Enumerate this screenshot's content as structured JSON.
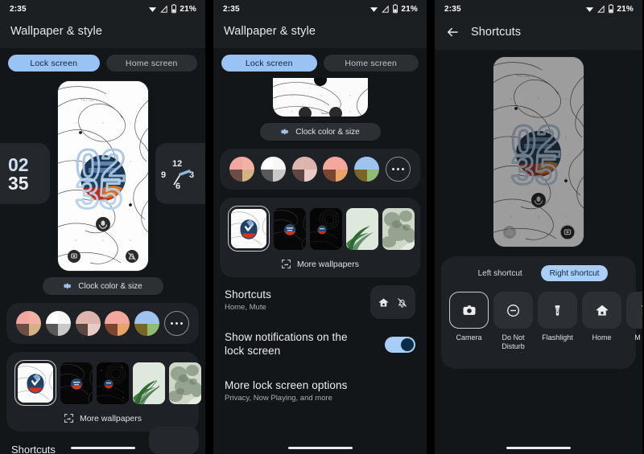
{
  "statusbar": {
    "time": "2:35",
    "battery": "21%",
    "icons": [
      "wifi-icon",
      "signal-icon",
      "battery-icon"
    ]
  },
  "panel1": {
    "app_title": "Wallpaper & style",
    "tabs": [
      {
        "label": "Lock screen",
        "active": true
      },
      {
        "label": "Home screen",
        "active": false
      }
    ],
    "preview": {
      "clock_time": "0235",
      "date": "Thu, Sep 1",
      "side_clock_left": "0235",
      "side_clock_right": "12 3 6 9"
    },
    "clock_pill": {
      "label": "Clock color & size",
      "icon": "gear-icon"
    },
    "color_swatches": [
      {
        "name": "swatch-pink-tan",
        "q1": "#f2a6a0",
        "q2": "#f3b0a4",
        "q3": "#6b4f46",
        "q4": "#d6b183"
      },
      {
        "name": "swatch-white-gray",
        "q1": "#ffffff",
        "q2": "#f7f7f7",
        "q3": "#59595a",
        "q4": "#c9c9c9"
      },
      {
        "name": "swatch-rose-mauve",
        "q1": "#e0b5ae",
        "q2": "#ddb4ad",
        "q3": "#5d4741",
        "q4": "#e8cbc4"
      },
      {
        "name": "swatch-salmon-orange",
        "q1": "#f4a79c",
        "q2": "#f4a79c",
        "q3": "#7b4530",
        "q4": "#e8a368"
      },
      {
        "name": "swatch-blue-green",
        "q1": "#9ec3ef",
        "q2": "#9ec3ef",
        "q3": "#7a6526",
        "q4": "#8fbb73"
      }
    ],
    "more_colors_label": "More colors",
    "wallpapers": [
      {
        "name": "wallpaper-current-selected",
        "selected": true
      },
      {
        "name": "wallpaper-dark-topo-1",
        "selected": false
      },
      {
        "name": "wallpaper-dark-topo-2",
        "selected": false
      },
      {
        "name": "wallpaper-palm-leaf",
        "selected": false
      },
      {
        "name": "wallpaper-green-marble",
        "selected": false
      }
    ],
    "more_wallpapers": {
      "label": "More wallpapers",
      "icon": "image-frame-icon"
    },
    "bottom_cut_label": "Shortcuts"
  },
  "panel2": {
    "app_title": "Wallpaper & style",
    "tabs": [
      {
        "label": "Lock screen",
        "active": true
      },
      {
        "label": "Home screen",
        "active": false
      }
    ],
    "clock_pill": {
      "label": "Clock color & size",
      "icon": "gear-icon"
    },
    "color_swatches": [
      {
        "name": "swatch-pink-tan",
        "q1": "#f2a6a0",
        "q2": "#f3b0a4",
        "q3": "#6b4f46",
        "q4": "#d6b183"
      },
      {
        "name": "swatch-white-gray",
        "q1": "#ffffff",
        "q2": "#f7f7f7",
        "q3": "#59595a",
        "q4": "#c9c9c9"
      },
      {
        "name": "swatch-rose-mauve",
        "q1": "#e0b5ae",
        "q2": "#ddb4ad",
        "q3": "#5d4741",
        "q4": "#e8cbc4"
      },
      {
        "name": "swatch-salmon-orange",
        "q1": "#f4a79c",
        "q2": "#f4a79c",
        "q3": "#7b4530",
        "q4": "#e8a368"
      },
      {
        "name": "swatch-blue-green",
        "q1": "#9ec3ef",
        "q2": "#9ec3ef",
        "q3": "#7a6526",
        "q4": "#8fbb73"
      }
    ],
    "wallpapers": [
      {
        "name": "wallpaper-current-selected",
        "selected": true
      },
      {
        "name": "wallpaper-dark-topo-1",
        "selected": false
      },
      {
        "name": "wallpaper-dark-topo-2",
        "selected": false
      },
      {
        "name": "wallpaper-palm-leaf",
        "selected": false
      },
      {
        "name": "wallpaper-green-marble",
        "selected": false
      }
    ],
    "more_wallpapers": {
      "label": "More wallpapers",
      "icon": "image-frame-icon"
    },
    "rows": [
      {
        "title": "Shortcuts",
        "subtitle": "Home, Mute",
        "trailing": "shortcut-icons",
        "icons": [
          "home-icon",
          "bell-off-icon"
        ]
      },
      {
        "title": "Show notifications on the lock screen",
        "subtitle": "",
        "trailing": "toggle",
        "toggle_on": true
      },
      {
        "title": "More lock screen options",
        "subtitle": "Privacy, Now Playing, and more",
        "trailing": "none"
      }
    ]
  },
  "panel3": {
    "app_title": "Shortcuts",
    "back_icon": "back-arrow-icon",
    "segments": [
      {
        "label": "Left shortcut",
        "active": false
      },
      {
        "label": "Right shortcut",
        "active": true
      }
    ],
    "shortcuts": [
      {
        "label": "Camera",
        "icon": "camera-icon",
        "selected": true
      },
      {
        "label": "Do Not Disturb",
        "icon": "do-not-disturb-icon",
        "selected": false
      },
      {
        "label": "Flashlight",
        "icon": "flashlight-icon",
        "selected": false
      },
      {
        "label": "Home",
        "icon": "home-icon",
        "selected": false
      },
      {
        "label": "M",
        "icon": "mute-icon",
        "selected": false
      }
    ]
  },
  "colors": {
    "accent": "#a9cef7",
    "panel_bg": "#131619",
    "card_bg": "#1e2226",
    "appbar_bg": "#1c1f22"
  }
}
